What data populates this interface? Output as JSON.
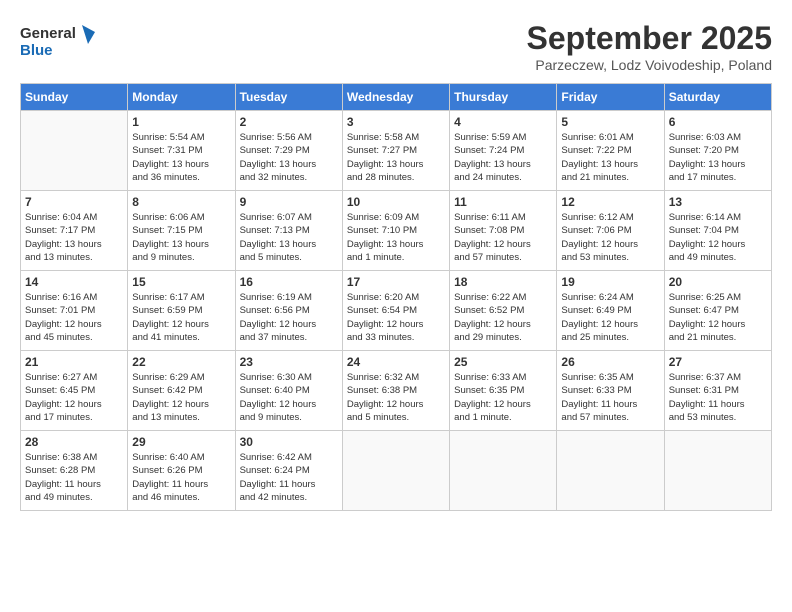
{
  "logo": {
    "line1": "General",
    "line2": "Blue"
  },
  "title": "September 2025",
  "subtitle": "Parzeczew, Lodz Voivodeship, Poland",
  "weekdays": [
    "Sunday",
    "Monday",
    "Tuesday",
    "Wednesday",
    "Thursday",
    "Friday",
    "Saturday"
  ],
  "weeks": [
    [
      {
        "day": "",
        "info": ""
      },
      {
        "day": "1",
        "info": "Sunrise: 5:54 AM\nSunset: 7:31 PM\nDaylight: 13 hours\nand 36 minutes."
      },
      {
        "day": "2",
        "info": "Sunrise: 5:56 AM\nSunset: 7:29 PM\nDaylight: 13 hours\nand 32 minutes."
      },
      {
        "day": "3",
        "info": "Sunrise: 5:58 AM\nSunset: 7:27 PM\nDaylight: 13 hours\nand 28 minutes."
      },
      {
        "day": "4",
        "info": "Sunrise: 5:59 AM\nSunset: 7:24 PM\nDaylight: 13 hours\nand 24 minutes."
      },
      {
        "day": "5",
        "info": "Sunrise: 6:01 AM\nSunset: 7:22 PM\nDaylight: 13 hours\nand 21 minutes."
      },
      {
        "day": "6",
        "info": "Sunrise: 6:03 AM\nSunset: 7:20 PM\nDaylight: 13 hours\nand 17 minutes."
      }
    ],
    [
      {
        "day": "7",
        "info": "Sunrise: 6:04 AM\nSunset: 7:17 PM\nDaylight: 13 hours\nand 13 minutes."
      },
      {
        "day": "8",
        "info": "Sunrise: 6:06 AM\nSunset: 7:15 PM\nDaylight: 13 hours\nand 9 minutes."
      },
      {
        "day": "9",
        "info": "Sunrise: 6:07 AM\nSunset: 7:13 PM\nDaylight: 13 hours\nand 5 minutes."
      },
      {
        "day": "10",
        "info": "Sunrise: 6:09 AM\nSunset: 7:10 PM\nDaylight: 13 hours\nand 1 minute."
      },
      {
        "day": "11",
        "info": "Sunrise: 6:11 AM\nSunset: 7:08 PM\nDaylight: 12 hours\nand 57 minutes."
      },
      {
        "day": "12",
        "info": "Sunrise: 6:12 AM\nSunset: 7:06 PM\nDaylight: 12 hours\nand 53 minutes."
      },
      {
        "day": "13",
        "info": "Sunrise: 6:14 AM\nSunset: 7:04 PM\nDaylight: 12 hours\nand 49 minutes."
      }
    ],
    [
      {
        "day": "14",
        "info": "Sunrise: 6:16 AM\nSunset: 7:01 PM\nDaylight: 12 hours\nand 45 minutes."
      },
      {
        "day": "15",
        "info": "Sunrise: 6:17 AM\nSunset: 6:59 PM\nDaylight: 12 hours\nand 41 minutes."
      },
      {
        "day": "16",
        "info": "Sunrise: 6:19 AM\nSunset: 6:56 PM\nDaylight: 12 hours\nand 37 minutes."
      },
      {
        "day": "17",
        "info": "Sunrise: 6:20 AM\nSunset: 6:54 PM\nDaylight: 12 hours\nand 33 minutes."
      },
      {
        "day": "18",
        "info": "Sunrise: 6:22 AM\nSunset: 6:52 PM\nDaylight: 12 hours\nand 29 minutes."
      },
      {
        "day": "19",
        "info": "Sunrise: 6:24 AM\nSunset: 6:49 PM\nDaylight: 12 hours\nand 25 minutes."
      },
      {
        "day": "20",
        "info": "Sunrise: 6:25 AM\nSunset: 6:47 PM\nDaylight: 12 hours\nand 21 minutes."
      }
    ],
    [
      {
        "day": "21",
        "info": "Sunrise: 6:27 AM\nSunset: 6:45 PM\nDaylight: 12 hours\nand 17 minutes."
      },
      {
        "day": "22",
        "info": "Sunrise: 6:29 AM\nSunset: 6:42 PM\nDaylight: 12 hours\nand 13 minutes."
      },
      {
        "day": "23",
        "info": "Sunrise: 6:30 AM\nSunset: 6:40 PM\nDaylight: 12 hours\nand 9 minutes."
      },
      {
        "day": "24",
        "info": "Sunrise: 6:32 AM\nSunset: 6:38 PM\nDaylight: 12 hours\nand 5 minutes."
      },
      {
        "day": "25",
        "info": "Sunrise: 6:33 AM\nSunset: 6:35 PM\nDaylight: 12 hours\nand 1 minute."
      },
      {
        "day": "26",
        "info": "Sunrise: 6:35 AM\nSunset: 6:33 PM\nDaylight: 11 hours\nand 57 minutes."
      },
      {
        "day": "27",
        "info": "Sunrise: 6:37 AM\nSunset: 6:31 PM\nDaylight: 11 hours\nand 53 minutes."
      }
    ],
    [
      {
        "day": "28",
        "info": "Sunrise: 6:38 AM\nSunset: 6:28 PM\nDaylight: 11 hours\nand 49 minutes."
      },
      {
        "day": "29",
        "info": "Sunrise: 6:40 AM\nSunset: 6:26 PM\nDaylight: 11 hours\nand 46 minutes."
      },
      {
        "day": "30",
        "info": "Sunrise: 6:42 AM\nSunset: 6:24 PM\nDaylight: 11 hours\nand 42 minutes."
      },
      {
        "day": "",
        "info": ""
      },
      {
        "day": "",
        "info": ""
      },
      {
        "day": "",
        "info": ""
      },
      {
        "day": "",
        "info": ""
      }
    ]
  ]
}
